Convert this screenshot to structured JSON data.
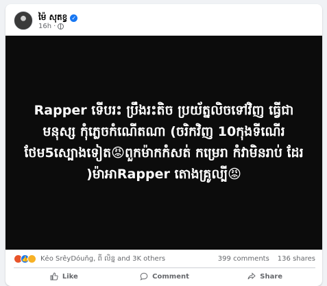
{
  "post": {
    "author": "ម៉ៃ សុតខ្វ",
    "time": "16h",
    "body_text": "Rapper ទើបរះ ប្រឹងរះតិច ប្រយ័ត្នលិចទៅវិញ ធ្វើជាមនុស្ស កុំភ្លេចកំណើតណា (ចរិកវិញ 10កុងទីណើរ ថែម5ស្បោងទៀត😡ពួកម៉ាកកំសត់ កម្រេរា កំវាមិនរាប់ ដែរ )ម៉ាអាRapper តោងគ្រូល្បី😡",
    "image_background": "#0c0c0c"
  },
  "reactions": {
    "icons": [
      "angry",
      "like",
      "haha"
    ],
    "summary": "Kẻo SrêyDóuňg, ពី លិន្ន and 3K others",
    "comments": "399 comments",
    "shares": "136 shares"
  },
  "actions": {
    "like": "Like",
    "comment": "Comment",
    "share": "Share"
  }
}
